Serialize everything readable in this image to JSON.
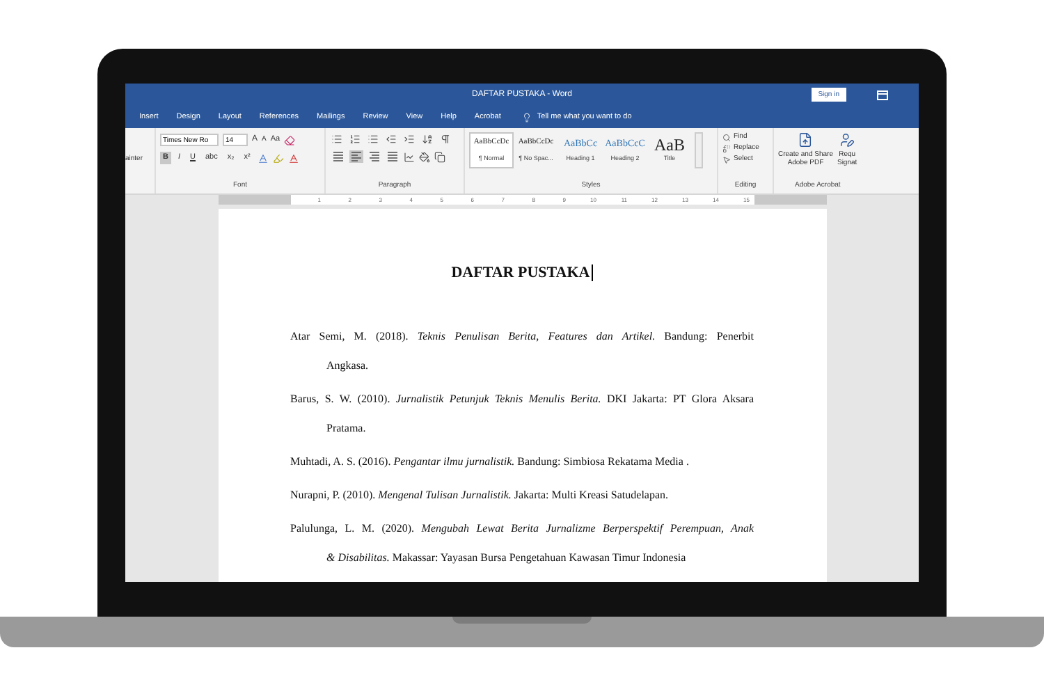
{
  "window": {
    "title": "DAFTAR PUSTAKA - Word",
    "sign_in": "Sign in"
  },
  "tabs": [
    {
      "label": "Insert"
    },
    {
      "label": "Design"
    },
    {
      "label": "Layout"
    },
    {
      "label": "References"
    },
    {
      "label": "Mailings"
    },
    {
      "label": "Review"
    },
    {
      "label": "View"
    },
    {
      "label": "Help"
    },
    {
      "label": "Acrobat"
    }
  ],
  "tell_me": "Tell me what you want to do",
  "ribbon": {
    "clipboard": {
      "label": "ainter"
    },
    "font": {
      "label": "Font",
      "font_name": "Times New Ro",
      "font_size": "14",
      "grow_button": "A",
      "shrink_button": "A",
      "case_button": "Aa",
      "format_buttons": [
        {
          "label": "B",
          "selected": true
        },
        {
          "label": "I",
          "selected": false
        },
        {
          "label": "U",
          "selected": false
        },
        {
          "label": "abc",
          "selected": false
        },
        {
          "label": "x₂",
          "selected": false
        },
        {
          "label": "x²",
          "selected": false
        }
      ]
    },
    "paragraph": {
      "label": "Paragraph",
      "alignments": [
        {
          "selected": false
        },
        {
          "selected": true
        },
        {
          "selected": false
        },
        {
          "selected": false
        }
      ]
    },
    "styles": {
      "label": "Styles",
      "items": [
        {
          "preview": "AaBbCcDc",
          "name": "¶ Normal",
          "selected": true
        },
        {
          "preview": "AaBbCcDc",
          "name": "¶ No Spac...",
          "selected": false
        },
        {
          "preview": "AaBbCc",
          "name": "Heading 1",
          "selected": false
        },
        {
          "preview": "AaBbCcC",
          "name": "Heading 2",
          "selected": false
        },
        {
          "preview": "AaB",
          "name": "Title",
          "selected": false
        }
      ]
    },
    "editing": {
      "label": "Editing",
      "items": [
        "Find",
        "Replace",
        "Select"
      ]
    },
    "acrobat": {
      "label": "Adobe Acrobat",
      "items": [
        {
          "line1": "Create and Share",
          "line2": "Adobe PDF"
        },
        {
          "line1": "Requ",
          "line2": "Signat"
        }
      ]
    }
  },
  "ruler": [
    "1",
    "2",
    "3",
    "4",
    "5",
    "6",
    "7",
    "8",
    "9",
    "10",
    "11",
    "12",
    "13",
    "14",
    "15"
  ],
  "document": {
    "heading": "DAFTAR PUSTAKA",
    "entries": [
      {
        "lines": [
          "Atar Semi, M. (2018). *Teknis Penulisan Berita, Features dan Artikel.* Bandung: Penerbit",
          "Angkasa."
        ]
      },
      {
        "lines": [
          "Barus, S. W. (2010). *Jurnalistik Petunjuk Teknis Menulis Berita.* DKI Jakarta: PT Glora Aksara",
          "Pratama."
        ]
      },
      {
        "lines": [
          "Muhtadi, A. S. (2016). *Pengantar ilmu jurnalistik.* Bandung: Simbiosa Rekatama Media ."
        ]
      },
      {
        "lines": [
          "Nurapni, P. (2010). *Mengenal Tulisan Jurnalistik.* Jakarta: Multi Kreasi Satudelapan."
        ]
      },
      {
        "lines": [
          "Palulunga, L. M. (2020). *Mengubah Lewat Berita Jurnalizme Berperspektif Perempuan, Anak*",
          "*& Disabilitas.* Makassar: Yayasan Bursa Pengetahuan Kawasan Timur Indonesia"
        ]
      }
    ]
  }
}
